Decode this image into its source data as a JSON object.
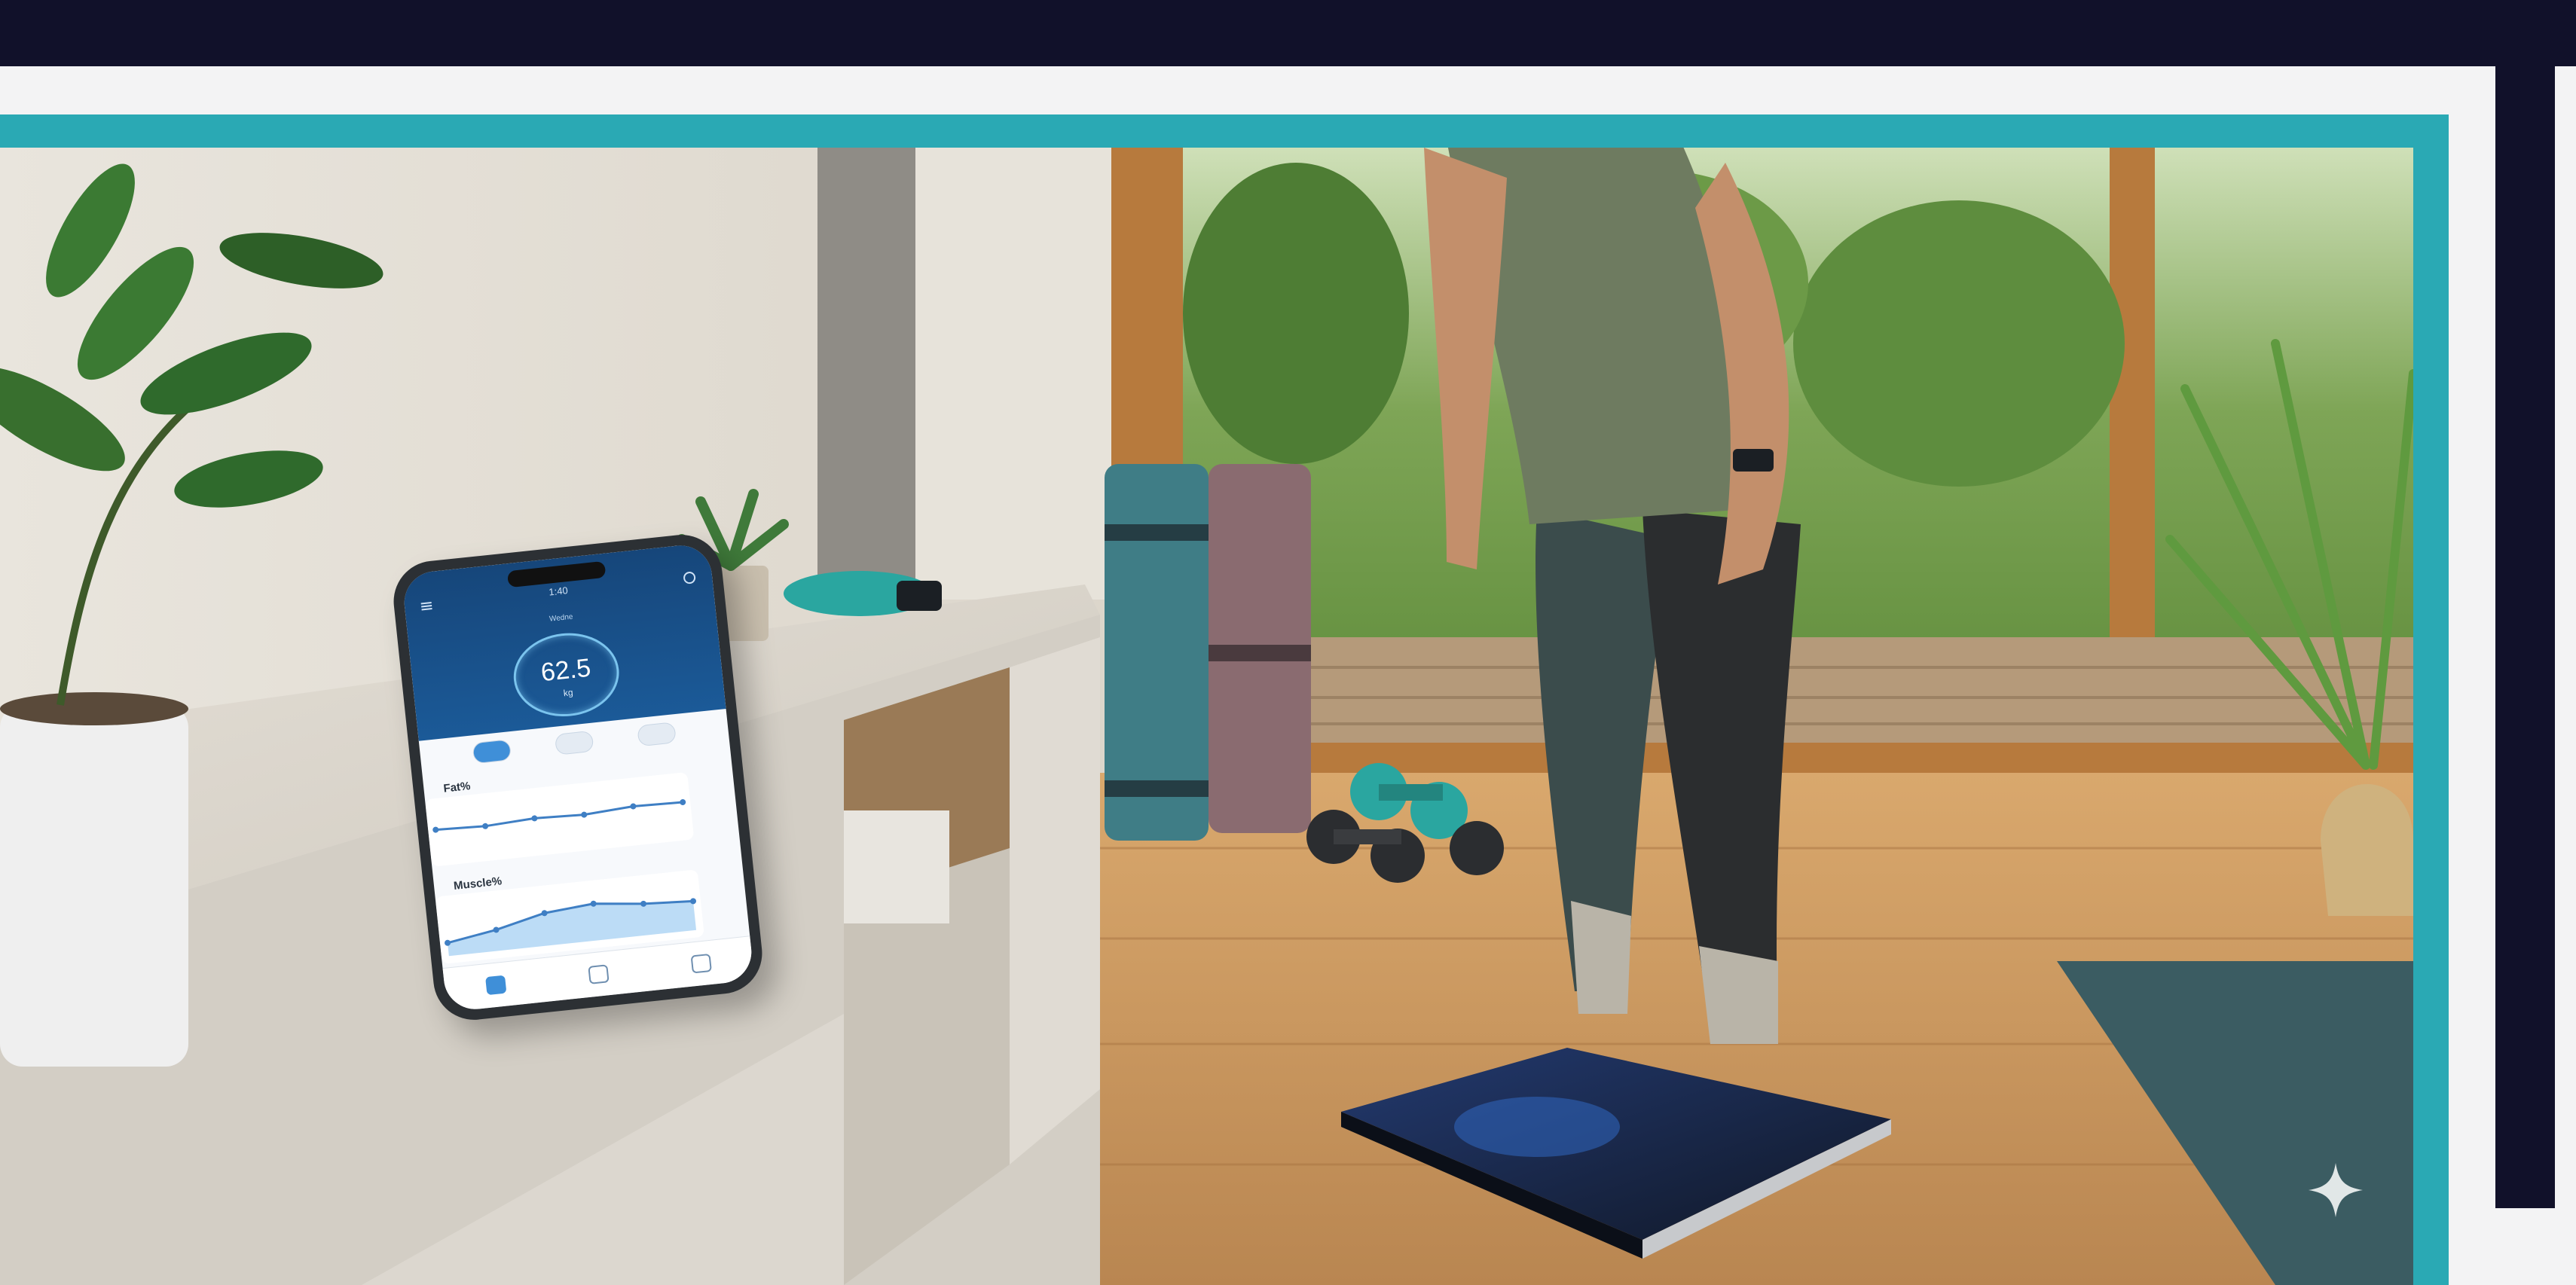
{
  "frame": {
    "background": "#f3f3f4",
    "navy": "#11112a",
    "teal": "#2aa9b4"
  },
  "phone_app": {
    "status_time": "1:40",
    "screen_label": "Wedne",
    "weight_value": "62.5",
    "weight_unit": "kg",
    "fat_label": "Fat%",
    "muscle_label": "Muscle%",
    "fat_trend": [
      0.55,
      0.52,
      0.57,
      0.54,
      0.6,
      0.58
    ],
    "muscle_trend": [
      0.25,
      0.4,
      0.62,
      0.7,
      0.6,
      0.55
    ]
  },
  "scene": {
    "description_icons": [
      "plant-icon",
      "smartwatch-icon",
      "yoga-mat-icon",
      "dumbbell-icon",
      "smart-scale-icon"
    ],
    "accent_colors": {
      "wall": "#e6e1d8",
      "cabinet": "#d6d2c9",
      "floor": "#c89a63",
      "window_green": "#6f9a4c",
      "mat_teal": "#3f7d86",
      "mat_mauve": "#8a6b70",
      "dumbbell": "#2aa6a0",
      "scale": "#1d2a4a"
    }
  }
}
